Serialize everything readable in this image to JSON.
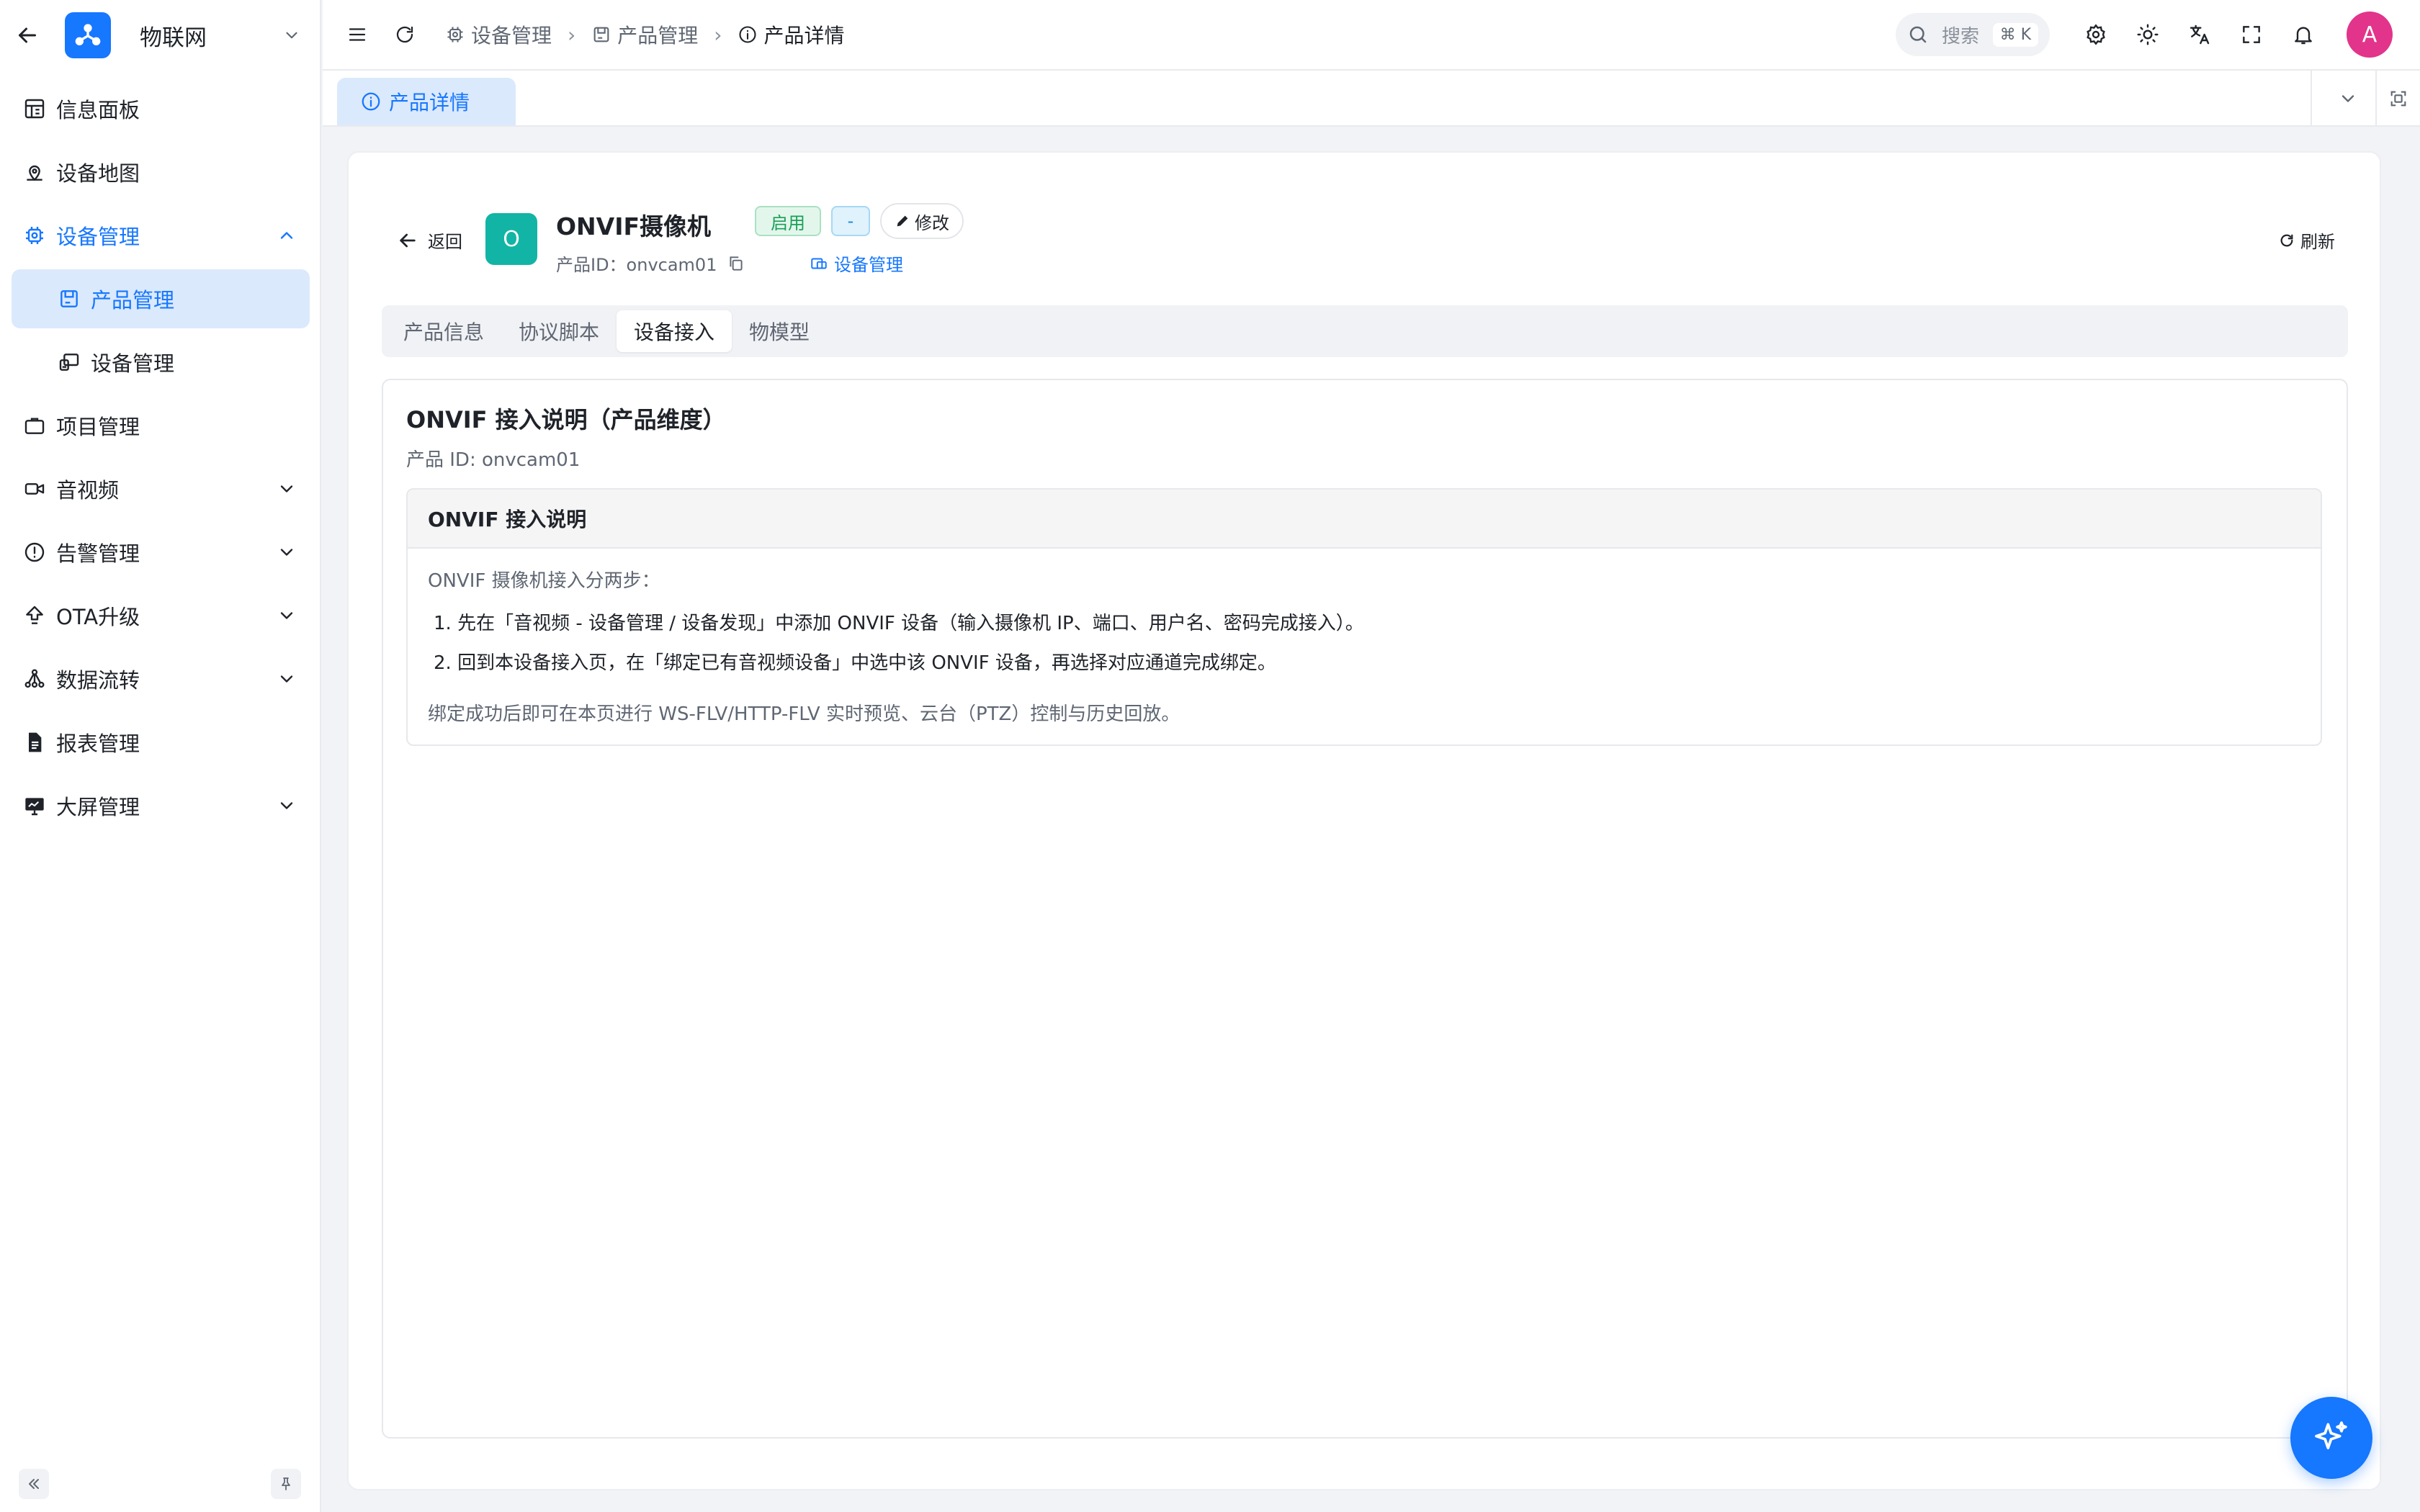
{
  "sidebar": {
    "app_name": "物联网",
    "items": [
      {
        "label": "信息面板"
      },
      {
        "label": "设备地图"
      },
      {
        "label": "设备管理"
      },
      {
        "label": "产品管理"
      },
      {
        "label": "设备管理"
      },
      {
        "label": "项目管理"
      },
      {
        "label": "音视频"
      },
      {
        "label": "告警管理"
      },
      {
        "label": "OTA升级"
      },
      {
        "label": "数据流转"
      },
      {
        "label": "报表管理"
      },
      {
        "label": "大屏管理"
      }
    ]
  },
  "header": {
    "breadcrumbs": [
      {
        "label": "设备管理"
      },
      {
        "label": "产品管理"
      },
      {
        "label": "产品详情"
      }
    ],
    "search_placeholder": "搜索",
    "search_shortcut": "⌘ K",
    "avatar_letter": "A"
  },
  "page_tab": {
    "label": "产品详情"
  },
  "product": {
    "back_label": "返回",
    "logo_letter": "O",
    "name": "ONVIF摄像机",
    "status_tag": "启用",
    "type_tag": "-",
    "edit_label": "修改",
    "id_text": "产品ID：onvcam01",
    "category_link": "设备管理",
    "refresh_label": "刷新"
  },
  "tabs": [
    {
      "label": "产品信息"
    },
    {
      "label": "协议脚本"
    },
    {
      "label": "设备接入",
      "active": true
    },
    {
      "label": "物模型"
    }
  ],
  "content": {
    "title": "ONVIF 接入说明（产品维度）",
    "subtitle": "产品 ID: onvcam01",
    "note_title": "ONVIF 接入说明",
    "intro": "ONVIF 摄像机接入分两步：",
    "steps": [
      "1. 先在「音视频 - 设备管理 / 设备发现」中添加 ONVIF 设备（输入摄像机 IP、端口、用户名、密码完成接入）。",
      "2. 回到本设备接入页，在「绑定已有音视频设备」中选中该 ONVIF 设备，再选择对应通道完成绑定。"
    ],
    "footer": "绑定成功后即可在本页进行 WS-FLV/HTTP-FLV 实时预览、云台（PTZ）控制与历史回放。"
  },
  "colors": {
    "accent": "#1677ff",
    "active_bg": "#dbe9fc",
    "status_green": "#1aa057",
    "product_logo": "#12b5a5",
    "avatar": "#e2348b"
  }
}
